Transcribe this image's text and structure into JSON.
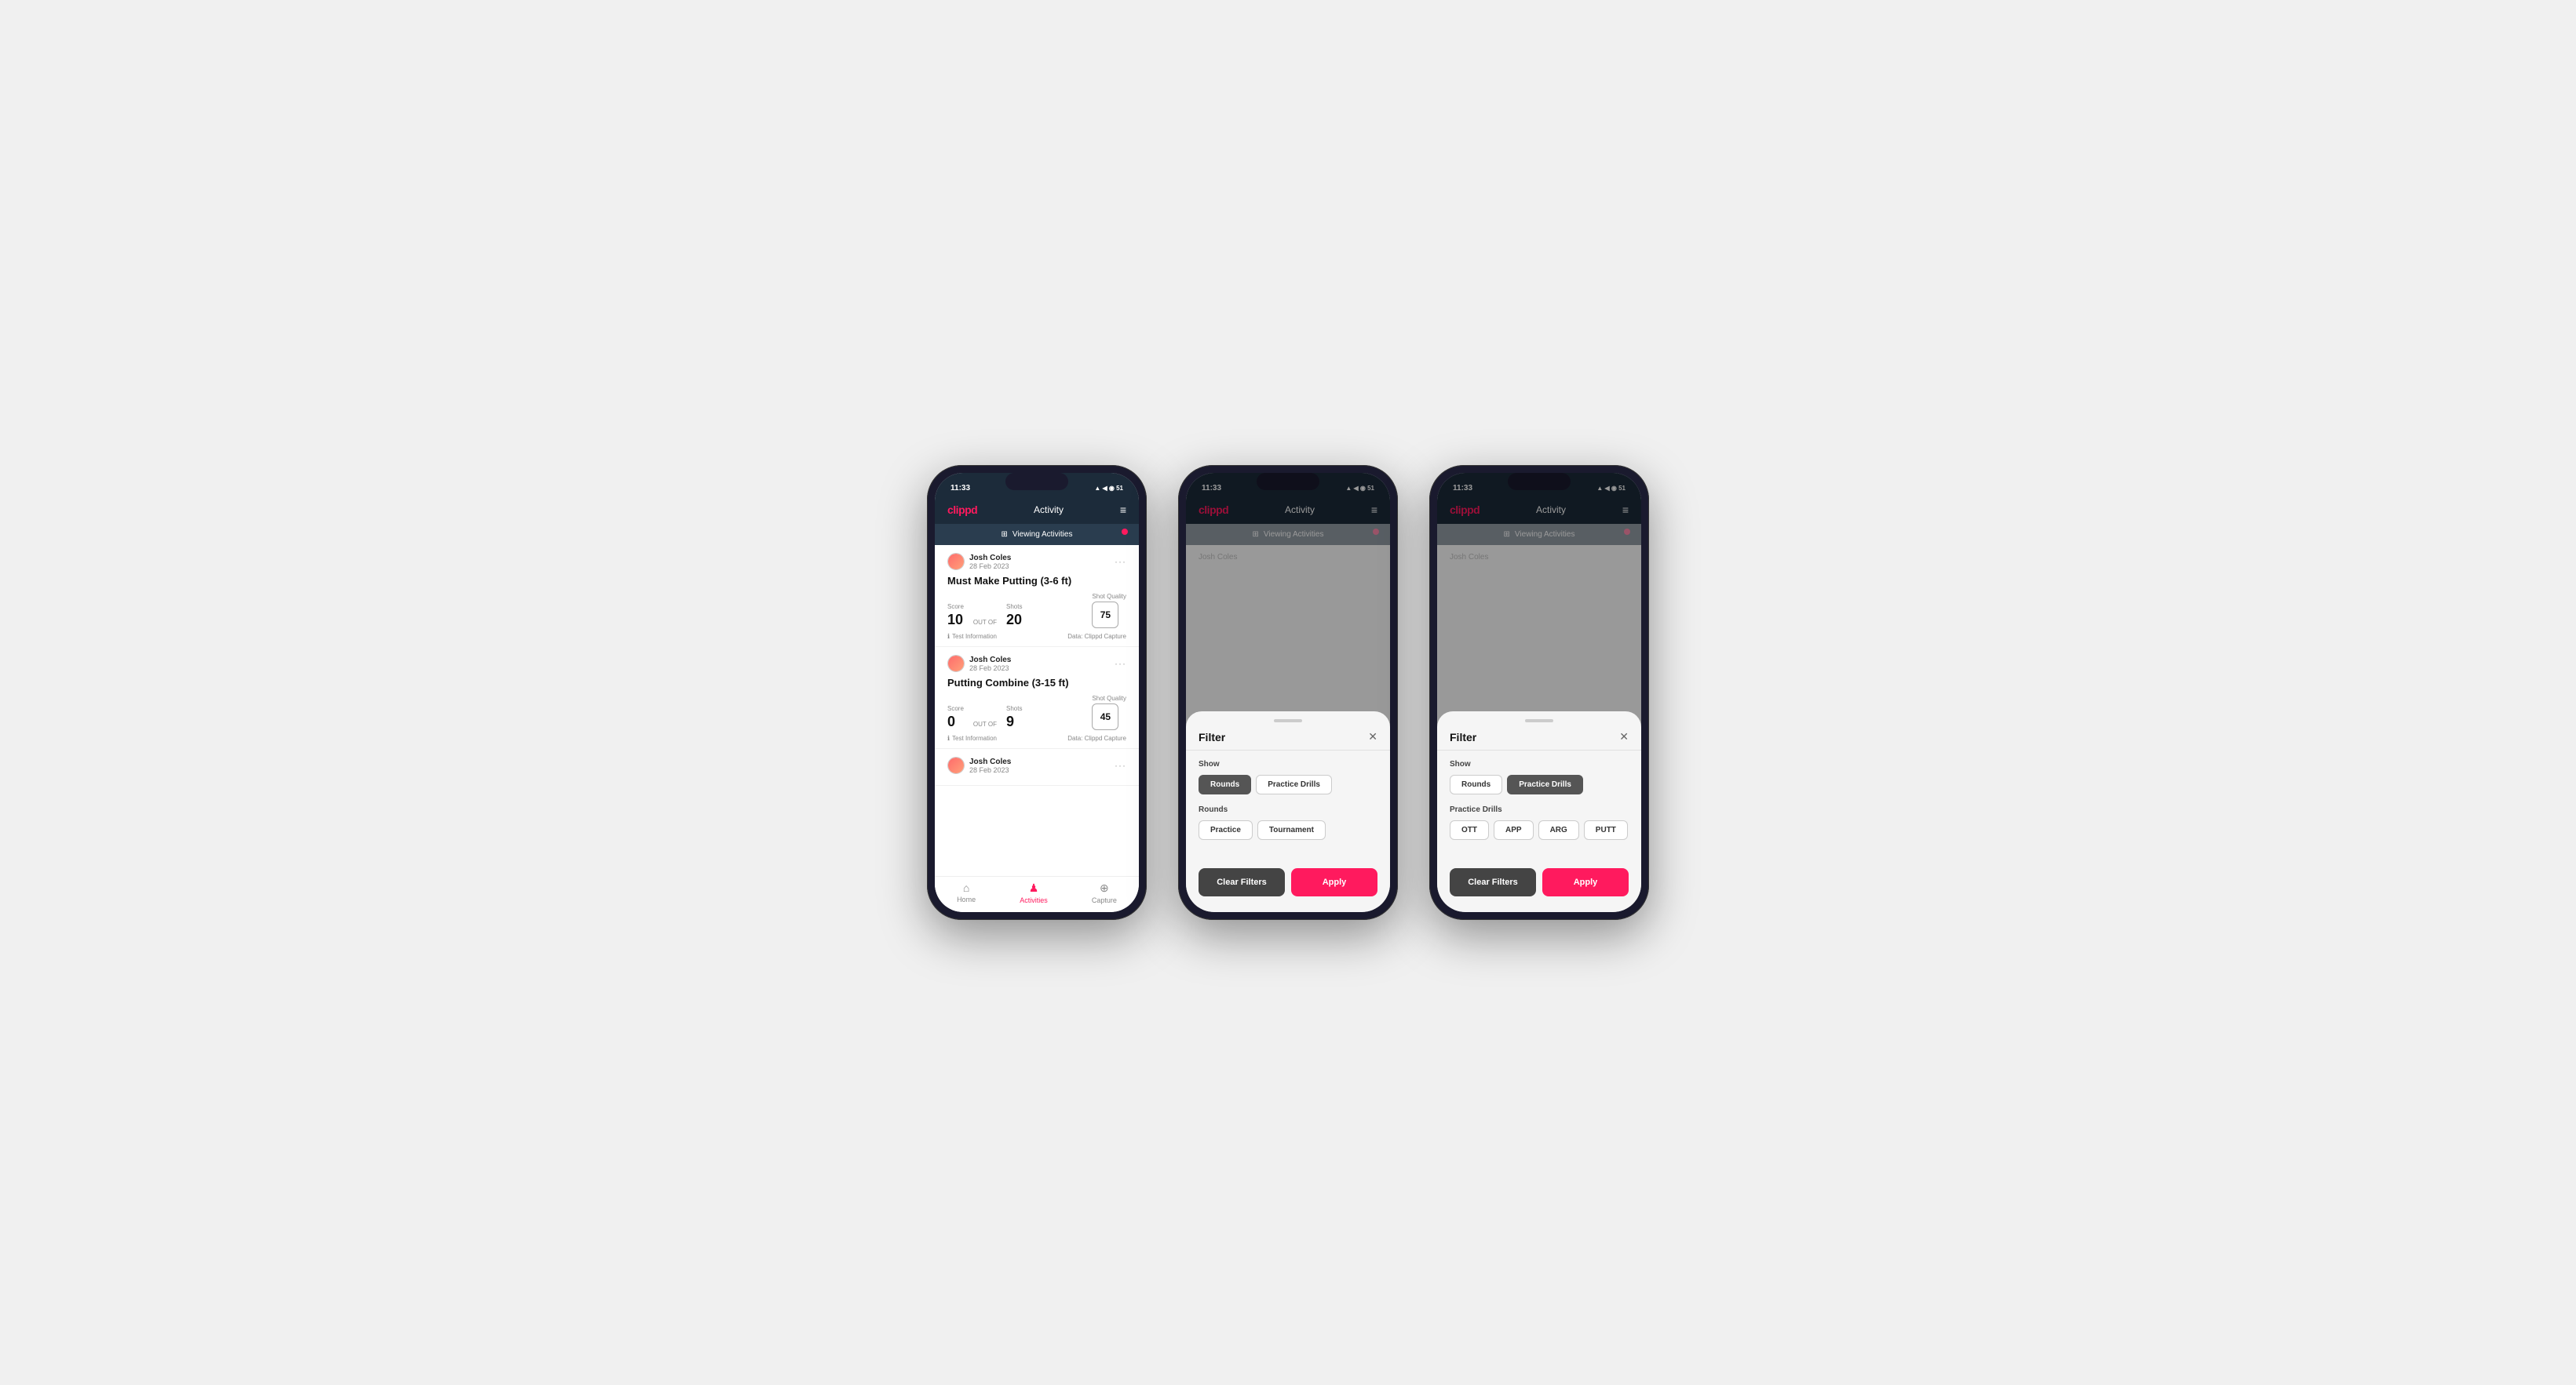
{
  "screen1": {
    "statusBar": {
      "time": "11:33",
      "icons": "▲ ◀ ◉ 51"
    },
    "nav": {
      "logo": "clippd",
      "title": "Activity",
      "menu": "≡"
    },
    "viewingBar": {
      "icon": "⊞",
      "text": "Viewing Activities"
    },
    "cards": [
      {
        "userName": "Josh Coles",
        "userDate": "28 Feb 2023",
        "title": "Must Make Putting (3-6 ft)",
        "scoreLbl": "Score",
        "scoreVal": "10",
        "outOf": "OUT OF",
        "shotsLbl": "Shots",
        "shotsVal": "20",
        "shotQualityLbl": "Shot Quality",
        "shotQualityVal": "75",
        "info": "Test Information",
        "data": "Data: Clippd Capture"
      },
      {
        "userName": "Josh Coles",
        "userDate": "28 Feb 2023",
        "title": "Putting Combine (3-15 ft)",
        "scoreLbl": "Score",
        "scoreVal": "0",
        "outOf": "OUT OF",
        "shotsLbl": "Shots",
        "shotsVal": "9",
        "shotQualityLbl": "Shot Quality",
        "shotQualityVal": "45",
        "info": "Test Information",
        "data": "Data: Clippd Capture"
      },
      {
        "userName": "Josh Coles",
        "userDate": "28 Feb 2023",
        "title": "",
        "scoreLbl": "",
        "scoreVal": "",
        "outOf": "",
        "shotsLbl": "",
        "shotsVal": "",
        "shotQualityLbl": "",
        "shotQualityVal": "",
        "info": "",
        "data": ""
      }
    ],
    "tabs": [
      {
        "icon": "⌂",
        "label": "Home",
        "active": false
      },
      {
        "icon": "♟",
        "label": "Activities",
        "active": true
      },
      {
        "icon": "+",
        "label": "Capture",
        "active": false
      }
    ]
  },
  "screen2": {
    "statusBar": {
      "time": "11:33",
      "icons": "▲ ◀ ◉ 51"
    },
    "nav": {
      "logo": "clippd",
      "title": "Activity",
      "menu": "≡"
    },
    "viewingBar": {
      "icon": "⊞",
      "text": "Viewing Activities"
    },
    "filter": {
      "title": "Filter",
      "showLabel": "Show",
      "showOptions": [
        {
          "label": "Rounds",
          "active": true
        },
        {
          "label": "Practice Drills",
          "active": false
        }
      ],
      "roundsLabel": "Rounds",
      "roundsOptions": [
        {
          "label": "Practice",
          "active": false
        },
        {
          "label": "Tournament",
          "active": false
        }
      ],
      "clearFilters": "Clear Filters",
      "apply": "Apply"
    }
  },
  "screen3": {
    "statusBar": {
      "time": "11:33",
      "icons": "▲ ◀ ◉ 51"
    },
    "nav": {
      "logo": "clippd",
      "title": "Activity",
      "menu": "≡"
    },
    "viewingBar": {
      "icon": "⊞",
      "text": "Viewing Activities"
    },
    "filter": {
      "title": "Filter",
      "showLabel": "Show",
      "showOptions": [
        {
          "label": "Rounds",
          "active": false
        },
        {
          "label": "Practice Drills",
          "active": true
        }
      ],
      "drillsLabel": "Practice Drills",
      "drillsOptions": [
        {
          "label": "OTT",
          "active": false
        },
        {
          "label": "APP",
          "active": false
        },
        {
          "label": "ARG",
          "active": false
        },
        {
          "label": "PUTT",
          "active": false
        }
      ],
      "clearFilters": "Clear Filters",
      "apply": "Apply"
    }
  }
}
